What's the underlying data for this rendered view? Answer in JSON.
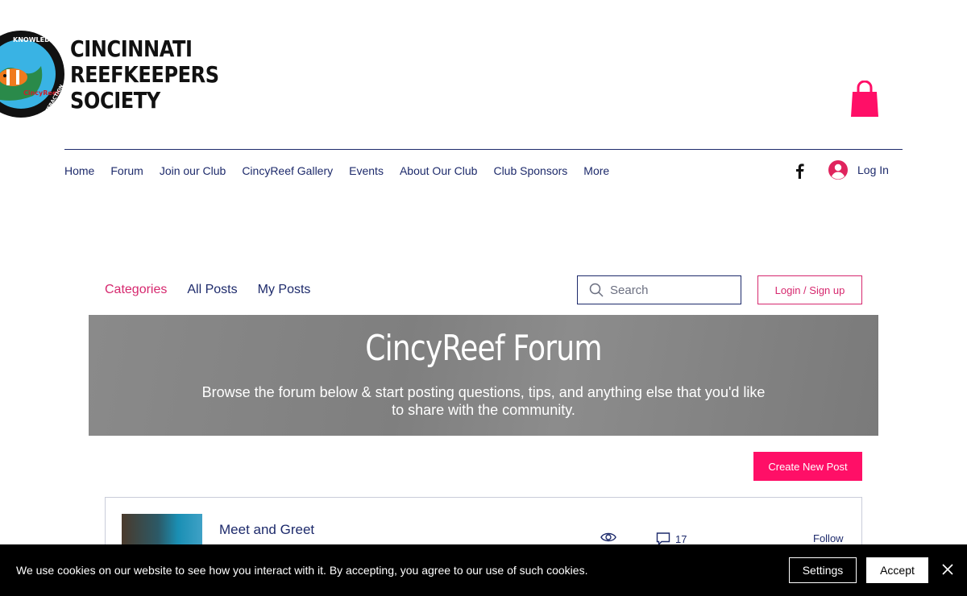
{
  "brand": {
    "lines": [
      "CINCINNATI",
      "REEFKEEPERS",
      "SOCIETY"
    ],
    "badge_text_top": "KNOWLEDGE",
    "badge_text_right": "INTERACTION",
    "badge_text_center": "CincyReef"
  },
  "nav": {
    "items": [
      "Home",
      "Forum",
      "Join our Club",
      "CincyReef Gallery",
      "Events",
      "About Our Club",
      "Club Sponsors",
      "More"
    ],
    "login_label": "Log In"
  },
  "forum": {
    "tabs": [
      "Categories",
      "All Posts",
      "My Posts"
    ],
    "search_placeholder": "Search",
    "login_signup": "Login / Sign up",
    "banner_title": "CincyReef Forum",
    "banner_subtitle": "Browse the forum below & start posting questions, tips, and anything else that you'd like to share with the community.",
    "create_post": "Create New Post",
    "category": {
      "title": "Meet and Greet",
      "comments_count": "17",
      "follow_label": "Follow"
    }
  },
  "cookie": {
    "message": "We use cookies on our website to see how you interact with it. By accepting, you agree to our use of such cookies.",
    "settings": "Settings",
    "accept": "Accept"
  },
  "colors": {
    "accent": "#ff0f67",
    "accent_text": "#d6286e",
    "nav_text": "#1d2a6b",
    "banner_bg": "#858585"
  },
  "icons": {
    "cart": "shopping-bag-icon",
    "facebook": "facebook-icon",
    "avatar": "user-avatar-icon",
    "search": "search-icon",
    "views": "eye-icon",
    "comments": "comment-icon",
    "close": "close-icon"
  }
}
